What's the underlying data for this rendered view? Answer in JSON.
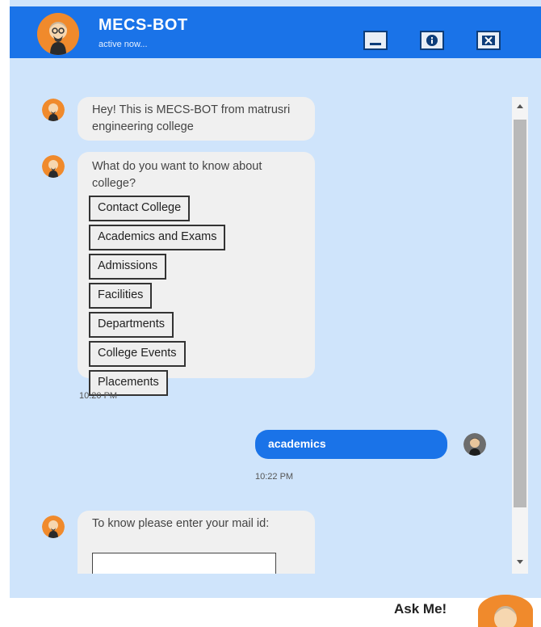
{
  "header": {
    "title": "MECS-BOT",
    "status": "active now...",
    "buttons": {
      "minimize": "minimize-icon",
      "info": "info-icon",
      "close": "close-icon"
    }
  },
  "messages": [
    {
      "sender": "bot",
      "text": "Hey! This is MECS-BOT from matrusri engineering college"
    },
    {
      "sender": "bot",
      "text": "What do you want to know about college?",
      "options": [
        "Contact College",
        "Academics and Exams",
        "Admissions",
        "Facilities",
        "Departments",
        "College Events",
        "Placements"
      ],
      "time": "10:20 PM"
    },
    {
      "sender": "user",
      "text": "academics",
      "time": "10:22 PM"
    },
    {
      "sender": "bot",
      "text": "To know please enter your mail id:",
      "input_value": ""
    }
  ],
  "launcher": {
    "label": "Ask Me!"
  },
  "colors": {
    "accent": "#1a73e8",
    "background": "#cfe4fb",
    "bubble": "#f0f0f0",
    "bot_avatar": "#f08a2c"
  }
}
